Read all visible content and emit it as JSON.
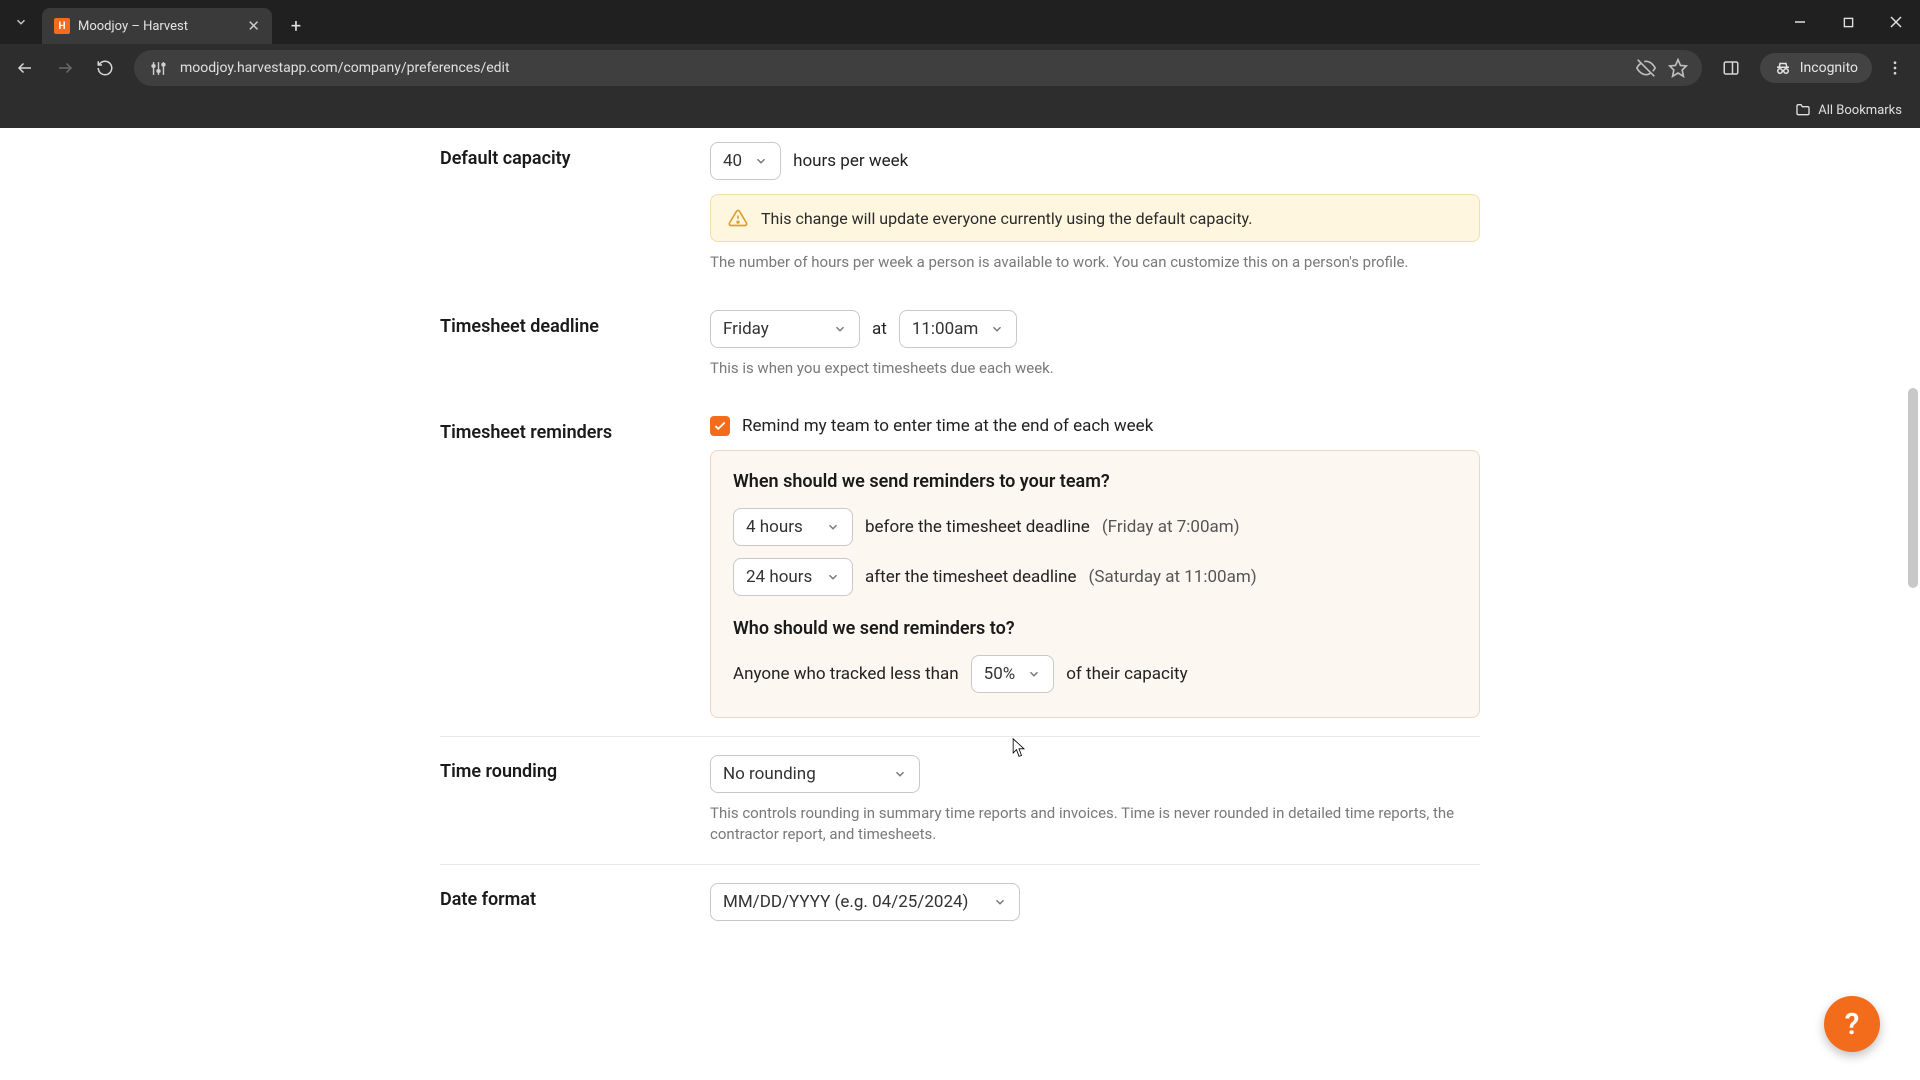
{
  "browser": {
    "tab_title": "Moodjoy – Harvest",
    "url": "moodjoy.harvestapp.com/company/preferences/edit",
    "incognito_label": "Incognito",
    "all_bookmarks": "All Bookmarks"
  },
  "capacity": {
    "label": "Default capacity",
    "value": "40",
    "suffix": "hours per week",
    "alert": "This change will update everyone currently using the default capacity.",
    "hint": "The number of hours per week a person is available to work. You can customize this on a person's profile."
  },
  "deadline": {
    "label": "Timesheet deadline",
    "day": "Friday",
    "at": "at",
    "time": "11:00am",
    "hint": "This is when you expect timesheets due each week."
  },
  "reminders": {
    "label": "Timesheet reminders",
    "checkbox_label": "Remind my team to enter time at the end of each week",
    "when_heading": "When should we send reminders to your team?",
    "before_value": "4 hours",
    "before_text": "before the timesheet deadline",
    "before_paren": "(Friday at 7:00am)",
    "after_value": "24 hours",
    "after_text": "after the timesheet deadline",
    "after_paren": "(Saturday at 11:00am)",
    "who_heading": "Who should we send reminders to?",
    "who_prefix": "Anyone who tracked less than",
    "who_value": "50%",
    "who_suffix": "of their capacity"
  },
  "rounding": {
    "label": "Time rounding",
    "value": "No rounding",
    "hint": "This controls rounding in summary time reports and invoices. Time is never rounded in detailed time reports, the contractor report, and timesheets."
  },
  "dateformat": {
    "label": "Date format",
    "value": "MM/DD/YYYY (e.g. 04/25/2024)"
  },
  "help": {
    "label": "?"
  }
}
